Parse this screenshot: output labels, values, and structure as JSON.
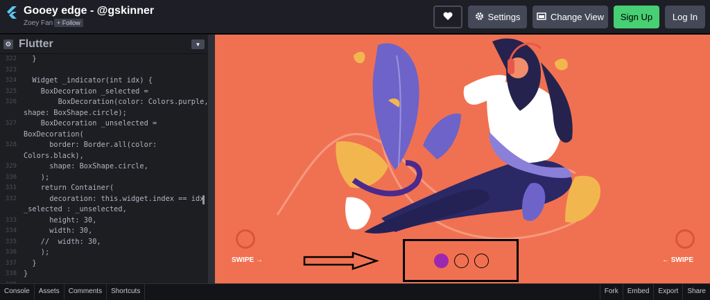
{
  "header": {
    "title": "Gooey edge - @gskinner",
    "author": "Zoey Fan",
    "follow_label": "+ Follow",
    "settings_label": "Settings",
    "change_view_label": "Change View",
    "signup_label": "Sign Up",
    "login_label": "Log In"
  },
  "editor": {
    "title": "Flutter",
    "lines": [
      {
        "num": "322",
        "text": "  }"
      },
      {
        "num": "323",
        "text": ""
      },
      {
        "num": "324",
        "text": "  Widget _indicator(int idx) {"
      },
      {
        "num": "325",
        "text": "    BoxDecoration _selected ="
      },
      {
        "num": "326",
        "text": "        BoxDecoration(color: Colors.purple,"
      },
      {
        "num": "",
        "text": "shape: BoxShape.circle);"
      },
      {
        "num": "327",
        "text": "    BoxDecoration _unselected ="
      },
      {
        "num": "",
        "text": "BoxDecoration("
      },
      {
        "num": "328",
        "text": "      border: Border.all(color:"
      },
      {
        "num": "",
        "text": "Colors.black),"
      },
      {
        "num": "329",
        "text": "      shape: BoxShape.circle,"
      },
      {
        "num": "330",
        "text": "    );"
      },
      {
        "num": "331",
        "text": "    return Container("
      },
      {
        "num": "332",
        "text": "      decoration: this.widget.index == idx ?"
      },
      {
        "num": "",
        "text": "_selected : _unselected,"
      },
      {
        "num": "333",
        "text": "      height: 30,"
      },
      {
        "num": "334",
        "text": "      width: 30,"
      },
      {
        "num": "335",
        "text": "    //  width: 30,"
      },
      {
        "num": "336",
        "text": "    );"
      },
      {
        "num": "337",
        "text": "  }"
      },
      {
        "num": "338",
        "text": "}"
      },
      {
        "num": "339",
        "text": ""
      }
    ]
  },
  "preview": {
    "swipe_left": "SWIPE →",
    "swipe_right": "← SWIPE",
    "selected_color": "#9c27b0",
    "background_color": "#f07151"
  },
  "footer": {
    "left_tabs": [
      "Console",
      "Assets",
      "Comments",
      "Shortcuts"
    ],
    "right_tabs": [
      "Fork",
      "Embed",
      "Export",
      "Share"
    ]
  }
}
